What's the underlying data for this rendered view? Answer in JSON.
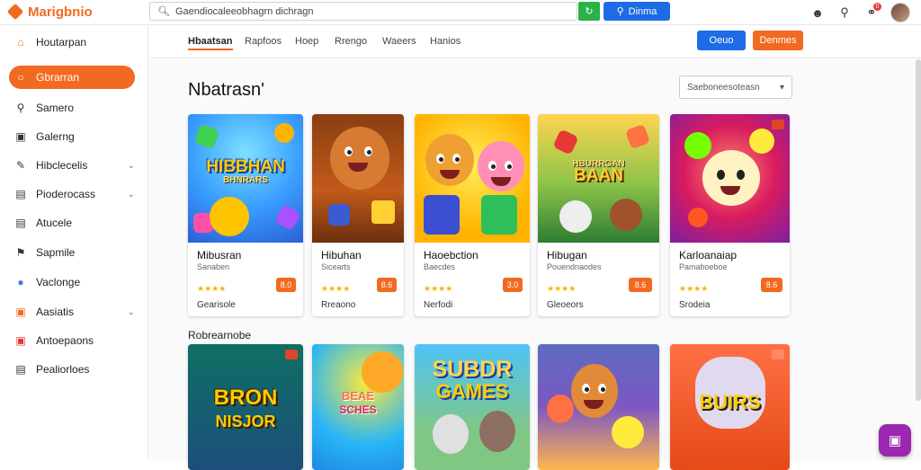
{
  "header": {
    "logo_text": "Marigbnio",
    "search_value": "Gaendiocaleeobhagrn dichragn",
    "search_button_label": "Dinma",
    "green_button_icon": "refresh-icon",
    "notification_count": "0"
  },
  "sidebar": {
    "items": [
      {
        "label": "Houtarpan",
        "icon": "home-icon",
        "chevron": false
      },
      {
        "label": "Gbrarran",
        "icon": "circle-icon",
        "chevron": false
      },
      {
        "label": "Samero",
        "icon": "search-icon",
        "chevron": false
      },
      {
        "label": "Galerng",
        "icon": "gallery-icon",
        "chevron": false
      },
      {
        "label": "Hibclecelis",
        "icon": "edit-icon",
        "chevron": true
      },
      {
        "label": "Pioderocass",
        "icon": "list-icon",
        "chevron": true
      },
      {
        "label": "Atucele",
        "icon": "document-icon",
        "chevron": false
      },
      {
        "label": "Sapmile",
        "icon": "tag-icon",
        "chevron": false
      },
      {
        "label": "Vaclonge",
        "icon": "users-icon",
        "chevron": false
      },
      {
        "label": "Aasiatis",
        "icon": "bookmark-icon",
        "chevron": true
      },
      {
        "label": "Antoepaons",
        "icon": "image-icon",
        "chevron": false
      },
      {
        "label": "Pealiorloes",
        "icon": "file-icon",
        "chevron": false
      }
    ]
  },
  "subnav": {
    "tabs": [
      "Hbaatsan",
      "Rapfoos",
      "Hoep",
      "Rrengo",
      "Waeers",
      "Hanios"
    ],
    "active_tab": 0,
    "blue_button": "Oeuo",
    "orange_button": "Denmes"
  },
  "main": {
    "title": "Nbatrasn'",
    "sort_value": "Saeboneesoteasn",
    "section_label": "Robrearnobe",
    "cards": [
      {
        "thumb_text": "HIBBHAN",
        "thumb_sub": "BHNRARS",
        "title": "Mibusran",
        "sub": "Sanaben",
        "rating": "★★★★",
        "price": "8.0",
        "foot": "Gearisole"
      },
      {
        "thumb_text": "",
        "thumb_sub": "",
        "title": "Hibuhan",
        "sub": "Sicearts",
        "rating": "★★★★",
        "price": "8.6",
        "foot": "Rreaono"
      },
      {
        "thumb_text": "",
        "thumb_sub": "",
        "title": "Haoebction",
        "sub": "Baecdes",
        "rating": "★★★★",
        "price": "3.0",
        "foot": "Nerfodi"
      },
      {
        "thumb_text": "BAAN",
        "thumb_sub": "HBURRGAN",
        "title": "Hibugan",
        "sub": "Pouendnaodes",
        "rating": "★★★★",
        "price": "8.6",
        "foot": "Gleoeors"
      },
      {
        "thumb_text": "",
        "thumb_sub": "",
        "title": "Karloanaiap",
        "sub": "Pamaboeboe",
        "rating": "★★★★",
        "price": "8.6",
        "foot": "Srodeia"
      }
    ],
    "cards_row2": [
      {
        "big": "BRON",
        "big2": "NISJOR"
      },
      {
        "big": "BEAE",
        "big2": "SCHES"
      },
      {
        "big": "SUBDR",
        "big2": "GAMES"
      },
      {
        "big": "",
        "big2": ""
      },
      {
        "big": "BUIRS",
        "big2": ""
      }
    ]
  },
  "colors": {
    "accent": "#f26a21",
    "primary": "#1e6be6",
    "fab": "#9c27b0"
  }
}
